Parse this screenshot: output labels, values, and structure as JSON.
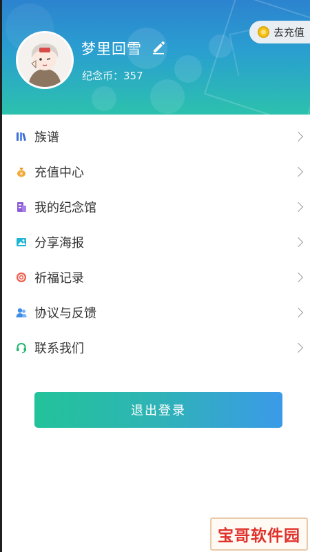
{
  "header": {
    "username": "梦里回雪",
    "coins_text": "纪念币：357",
    "recharge_label": "去充值"
  },
  "menu": {
    "items": [
      {
        "label": "族谱",
        "icon": "genealogy-icon",
        "color": "#3d6fd8"
      },
      {
        "label": "充值中心",
        "icon": "money-bag-icon",
        "color": "#f2a93b"
      },
      {
        "label": "我的纪念馆",
        "icon": "memorial-hall-icon",
        "color": "#8b5cd6"
      },
      {
        "label": "分享海报",
        "icon": "poster-image-icon",
        "color": "#1fb6d6"
      },
      {
        "label": "祈福记录",
        "icon": "blessing-icon",
        "color": "#ee5b4b"
      },
      {
        "label": "协议与反馈",
        "icon": "users-icon",
        "color": "#3f8de8"
      },
      {
        "label": "联系我们",
        "icon": "headset-icon",
        "color": "#25b86f"
      }
    ]
  },
  "logout_label": "退出登录",
  "watermark_text": "宝哥软件园",
  "colors": {
    "header_top": "#2c83cf",
    "header_bottom": "#2cc1ad",
    "logout_start": "#22c39a",
    "logout_end": "#3b9ae8"
  }
}
